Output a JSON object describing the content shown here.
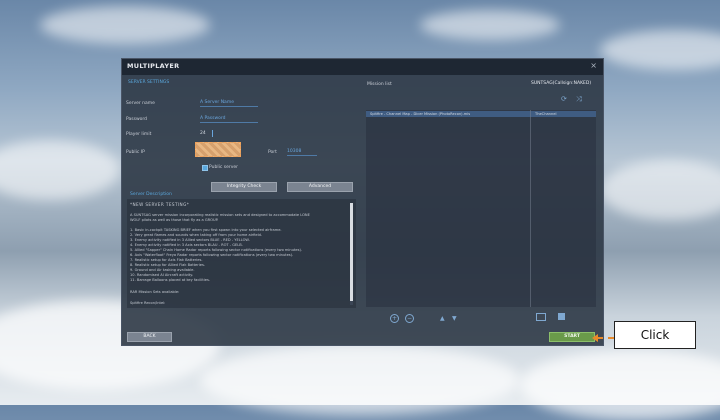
{
  "dialog": {
    "title": "MULTIPLAYER",
    "close_glyph": "×"
  },
  "server_settings": {
    "header": "SERVER SETTINGS",
    "server_name_label": "Server name",
    "server_name_value": "A Server Name",
    "password_label": "Password",
    "password_value": "A Password",
    "player_limit_label": "Player limit",
    "player_limit_value": "24",
    "public_ip_label": "Public IP",
    "port_label": "Port",
    "port_value": "10308",
    "public_server_label": "Public server",
    "integrity_check_label": "Integrity Check",
    "advanced_label": "Advanced"
  },
  "description": {
    "header": "Server Description",
    "lines": [
      "*NEW SERVER TESTING*",
      "",
      "A SUNTSAG server mission incorporating realistic mission sets and designed to accommodate LONE",
      "WOLF pilots as well as those that fly as a GROUP.",
      "",
      "1.    Basic in-cockpit TASKING BRIEF when you first spawn into your selected airframe.",
      "2.    Very great flames and sounds when taking off from your home airfield.",
      "3.    Enemy activity notified in 3 Allied sectors BLUE - RED - YELLOW.",
      "4.    Enemy activity notified in 3 Axis sectors BLAU - ROT - GELB.",
      "5.    Allied \"Sapper\" Chain Home Radar reports following sector notifications (every two minutes).",
      "6.    Axis \"Waterfloat\" Freya Radar reports following sector notifications (every two minutes).",
      "7.    Realistic setup for Axis Flak Batteries.",
      "8.    Realistic setup for Allied Flak Batteries.",
      "9.    Ground and Air tasking available.",
      "10.    Randomised AI Aircraft activity.",
      "11.    Barrage Balloons placed at key facilities.",
      "",
      "RAR Mission Sets available:",
      "",
      "Spitfire Recon/Intel:"
    ]
  },
  "mission_list": {
    "header": "Mission list",
    "callsign": "SUNTSAG(Callsign:NAKED)",
    "rows": [
      {
        "mission": "Spitfire - Channel Map - Dicer Mission (PhotoRecon).mis",
        "map": "TheChannel"
      }
    ]
  },
  "footer": {
    "back_label": "BACK",
    "start_label": "START"
  },
  "annotation": {
    "callout_text": "Click",
    "arrow_color": "#e88a2a"
  },
  "icons": [
    "refresh-icon",
    "shuffle-icon",
    "add-icon",
    "remove-icon",
    "move-up-icon",
    "move-down-icon",
    "folder-icon",
    "save-icon"
  ]
}
